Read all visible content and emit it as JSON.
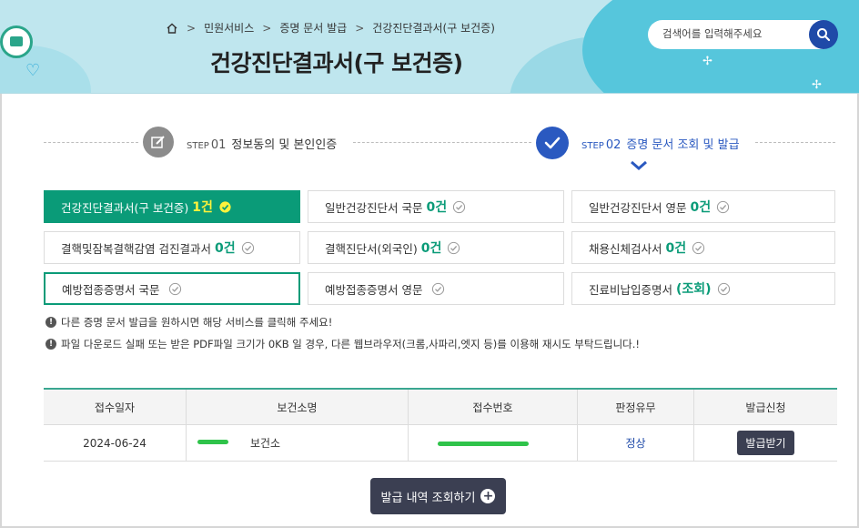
{
  "header": {
    "breadcrumb": [
      "민원서비스",
      "증명 문서 발급",
      "건강진단결과서(구 보건증)"
    ],
    "title": "건강진단결과서(구 보건증)",
    "search_placeholder": "검색어를 입력해주세요"
  },
  "steps": [
    {
      "label": "STEP",
      "num": "01",
      "text": "정보동의 및 본인인증",
      "state": "done"
    },
    {
      "label": "STEP",
      "num": "02",
      "text": "증명 문서 조회 및 발급",
      "state": "current"
    }
  ],
  "documents": [
    {
      "name": "건강진단결과서(구 보건증)",
      "count": "1건",
      "state": "active"
    },
    {
      "name": "일반건강진단서 국문",
      "count": "0건"
    },
    {
      "name": "일반건강진단서 영문",
      "count": "0건"
    },
    {
      "name": "결핵및잠복결핵감염 검진결과서",
      "count": "0건"
    },
    {
      "name": "결핵진단서(외국인)",
      "count": "0건"
    },
    {
      "name": "채용신체검사서",
      "count": "0건"
    },
    {
      "name": "예방접종증명서 국문",
      "count": "",
      "state": "outlined"
    },
    {
      "name": "예방접종증명서 영문",
      "count": ""
    },
    {
      "name": "진료비납입증명서",
      "count": "(조회)"
    }
  ],
  "notices": [
    "다른 증명 문서 발급을 원하시면 해당 서비스를 클릭해 주세요!",
    "파일 다운로드 실패 또는 받은 PDF파일 크기가 0KB 일 경우, 다른 웹브라우저(크롬,사파리,엣지 등)를 이용해 재시도 부탁드립니다.!"
  ],
  "table": {
    "columns": [
      "접수일자",
      "보건소명",
      "접수번호",
      "판정유무",
      "발급신청"
    ],
    "rows": [
      {
        "date": "2024-06-24",
        "center": "보건소",
        "receipt": "",
        "judgement": "정상",
        "action": "발급받기"
      }
    ]
  },
  "history_button": "발급 내역 조회하기",
  "colors": {
    "primary_green": "#0a9b78",
    "primary_blue": "#2a59c0",
    "dark_button": "#3b3f52",
    "banner": "#bfe6ee"
  }
}
